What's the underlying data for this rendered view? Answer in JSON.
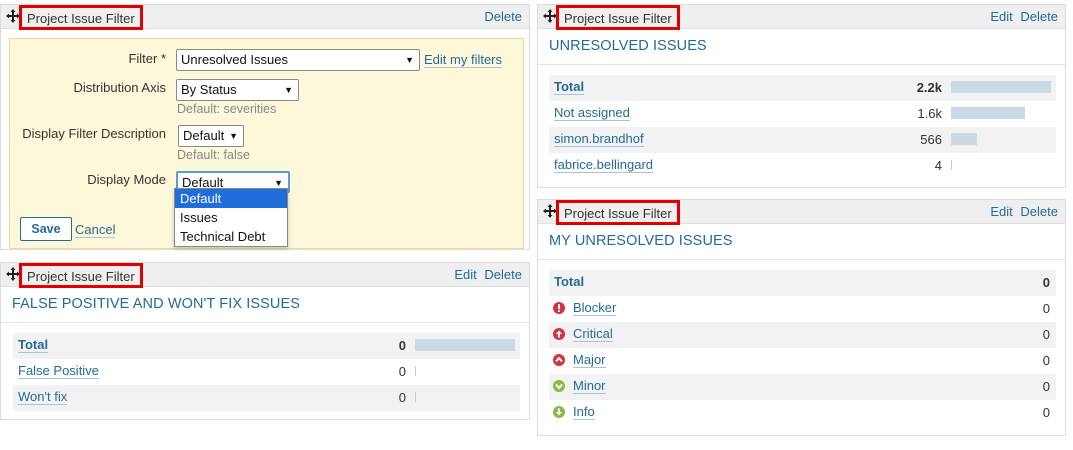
{
  "widget_edit": {
    "title": "Project Issue Filter",
    "actions": [
      "Delete"
    ],
    "form": {
      "filter_label": "Filter *",
      "filter_value": "Unresolved Issues",
      "edit_filters_link": "Edit my filters",
      "axis_label": "Distribution Axis",
      "axis_value": "By Status",
      "axis_default": "Default: severities",
      "desc_label": "Display Filter Description",
      "desc_value": "Default",
      "desc_default": "Default: false",
      "mode_label": "Display Mode",
      "mode_value": "Default",
      "mode_options": [
        "Default",
        "Issues",
        "Technical Debt"
      ],
      "save_label": "Save",
      "cancel_label": "Cancel"
    }
  },
  "widget_fp": {
    "title": "Project Issue Filter",
    "actions": [
      "Edit",
      "Delete"
    ],
    "heading": "FALSE POSITIVE AND WON'T FIX ISSUES",
    "rows": [
      {
        "label": "Total",
        "value": "0",
        "fill": 1.0
      },
      {
        "label": "False Positive",
        "value": "0",
        "fill": 0
      },
      {
        "label": "Won't fix",
        "value": "0",
        "fill": 0
      }
    ]
  },
  "widget_unresolved": {
    "title": "Project Issue Filter",
    "actions": [
      "Edit",
      "Delete"
    ],
    "heading": "UNRESOLVED ISSUES",
    "rows": [
      {
        "label": "Total",
        "value": "2.2k",
        "fill": 1.0
      },
      {
        "label": "Not assigned",
        "value": "1.6k",
        "fill": 0.74
      },
      {
        "label": "simon.brandhof",
        "value": "566",
        "fill": 0.26
      },
      {
        "label": "fabrice.bellingard",
        "value": "4",
        "fill": 0
      }
    ]
  },
  "widget_my": {
    "title": "Project Issue Filter",
    "actions": [
      "Edit",
      "Delete"
    ],
    "heading": "MY UNRESOLVED ISSUES",
    "rows": [
      {
        "label": "Total",
        "value": "0",
        "icon": ""
      },
      {
        "label": "Blocker",
        "value": "0",
        "icon": "blocker-icon",
        "color": "#d4333f"
      },
      {
        "label": "Critical",
        "value": "0",
        "icon": "critical-icon",
        "color": "#d4333f"
      },
      {
        "label": "Major",
        "value": "0",
        "icon": "major-icon",
        "color": "#d4333f"
      },
      {
        "label": "Minor",
        "value": "0",
        "icon": "minor-icon",
        "color": "#87bb43"
      },
      {
        "label": "Info",
        "value": "0",
        "icon": "info-icon",
        "color": "#87bb43"
      }
    ]
  }
}
